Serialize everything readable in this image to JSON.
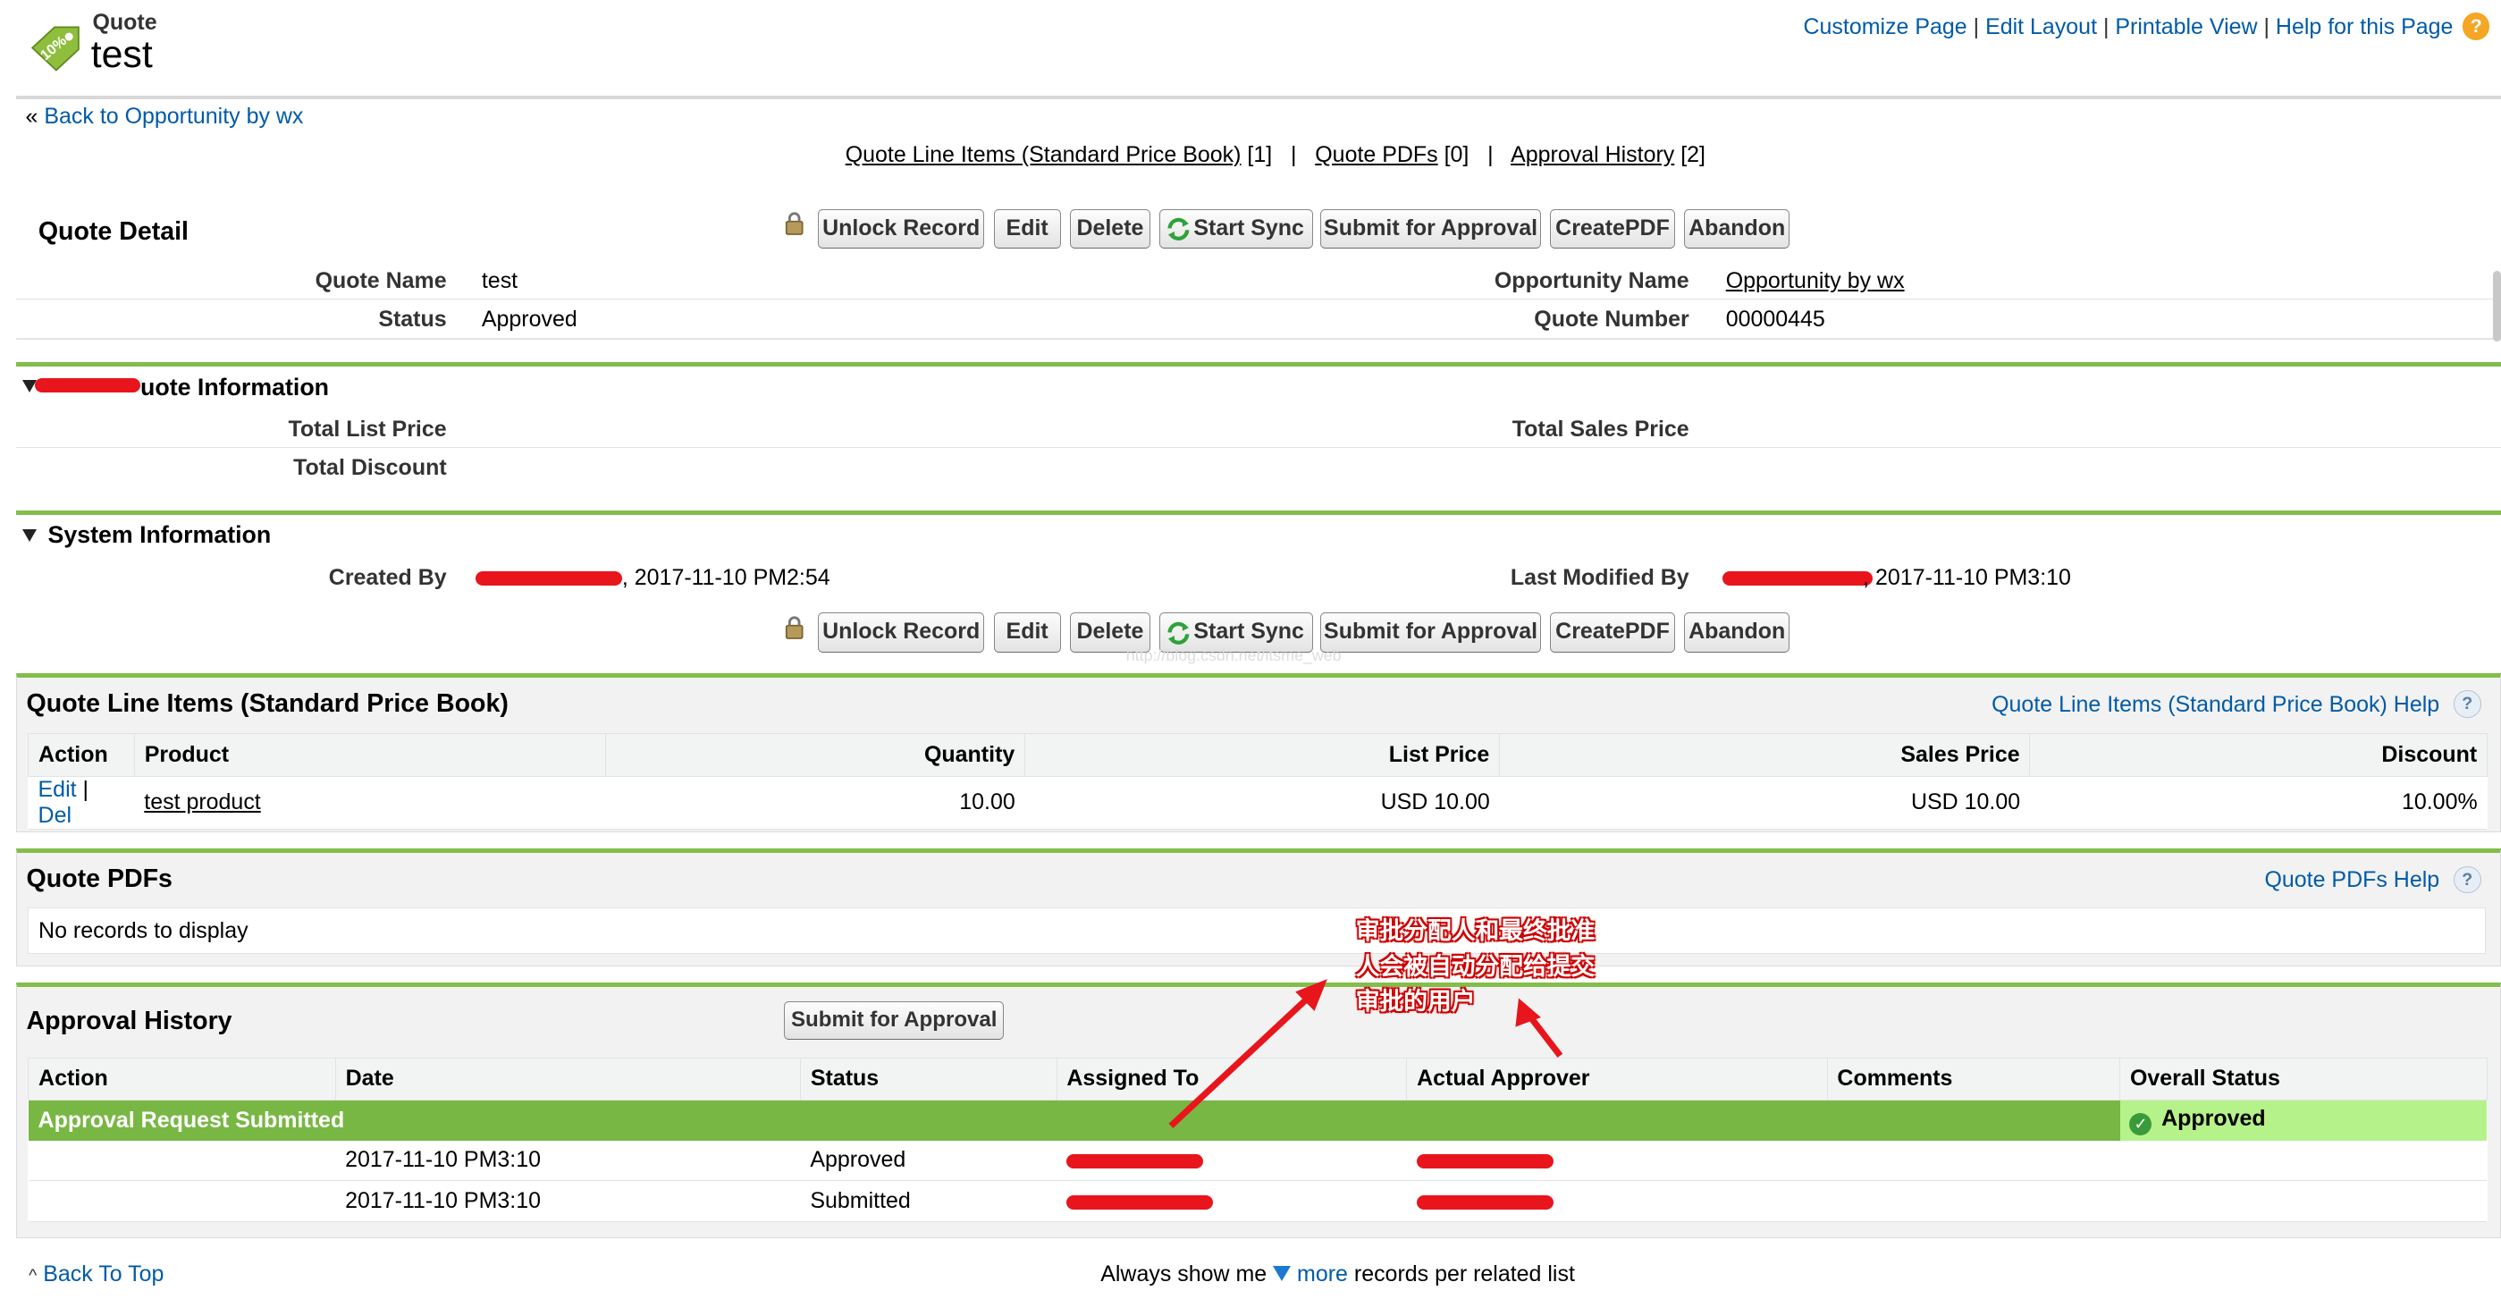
{
  "header": {
    "object_type": "Quote",
    "record_name": "test",
    "top_links": [
      "Customize Page",
      "Edit Layout",
      "Printable View",
      "Help for this Page"
    ]
  },
  "back_link": "Back to Opportunity by wx",
  "related_links": [
    {
      "label": "Quote Line Items (Standard Price Book)",
      "count": "[1]"
    },
    {
      "label": "Quote PDFs",
      "count": "[0]"
    },
    {
      "label": "Approval History",
      "count": "[2]"
    }
  ],
  "buttons": {
    "unlock": "Unlock Record",
    "edit": "Edit",
    "delete": "Delete",
    "start_sync": "Start Sync",
    "submit": "Submit for Approval",
    "create_pdf": "CreatePDF",
    "abandon": "Abandon"
  },
  "detail": {
    "title": "Quote Detail",
    "quote_name_label": "Quote Name",
    "quote_name": "test",
    "status_label": "Status",
    "status": "Approved",
    "opp_name_label": "Opportunity Name",
    "opp_name": "Opportunity by wx",
    "quote_number_label": "Quote Number",
    "quote_number": "00000445"
  },
  "quote_info": {
    "title_suffix": "uote Information",
    "total_list_price": "Total List Price",
    "total_sales_price": "Total Sales Price",
    "total_discount": "Total Discount"
  },
  "system_info": {
    "title": "System Information",
    "created_by_label": "Created By",
    "created_by_time": ", 2017-11-10 PM2:54",
    "modified_by_label": "Last Modified By",
    "modified_by_time": ", 2017-11-10 PM3:10"
  },
  "line_items": {
    "title": "Quote Line Items (Standard Price Book)",
    "help": "Quote Line Items (Standard Price Book) Help",
    "columns": [
      "Action",
      "Product",
      "Quantity",
      "List Price",
      "Sales Price",
      "Discount"
    ],
    "rows": [
      {
        "edit": "Edit",
        "del": "Del",
        "product": "test product",
        "quantity": "10.00",
        "list_price": "USD 10.00",
        "sales_price": "USD 10.00",
        "discount": "10.00%"
      }
    ]
  },
  "pdfs": {
    "title": "Quote PDFs",
    "help": "Quote PDFs Help",
    "empty": "No records to display"
  },
  "approval": {
    "title": "Approval History",
    "submit_button": "Submit for Approval",
    "columns": [
      "Action",
      "Date",
      "Status",
      "Assigned To",
      "Actual Approver",
      "Comments",
      "Overall Status"
    ],
    "group_label": "Approval Request Submitted",
    "overall_status": "Approved",
    "rows": [
      {
        "date": "2017-11-10 PM3:10",
        "status": "Approved"
      },
      {
        "date": "2017-11-10 PM3:10",
        "status": "Submitted"
      }
    ]
  },
  "annotation": {
    "line1": "审批分配人和最终批准",
    "line2": "人会被自动分配给提交",
    "line3": "审批的用户"
  },
  "footer": {
    "back_to_top": "Back To Top",
    "always_show": "Always show me",
    "more": "more",
    "per_list": "records per related list"
  },
  "watermark": "http://blog.csdn.net/itsme_web",
  "colors": {
    "accent_green": "#83bd4a",
    "link_blue": "#015ba7",
    "redaction": "#e8151c",
    "approved_bg": "#b6f28a"
  }
}
